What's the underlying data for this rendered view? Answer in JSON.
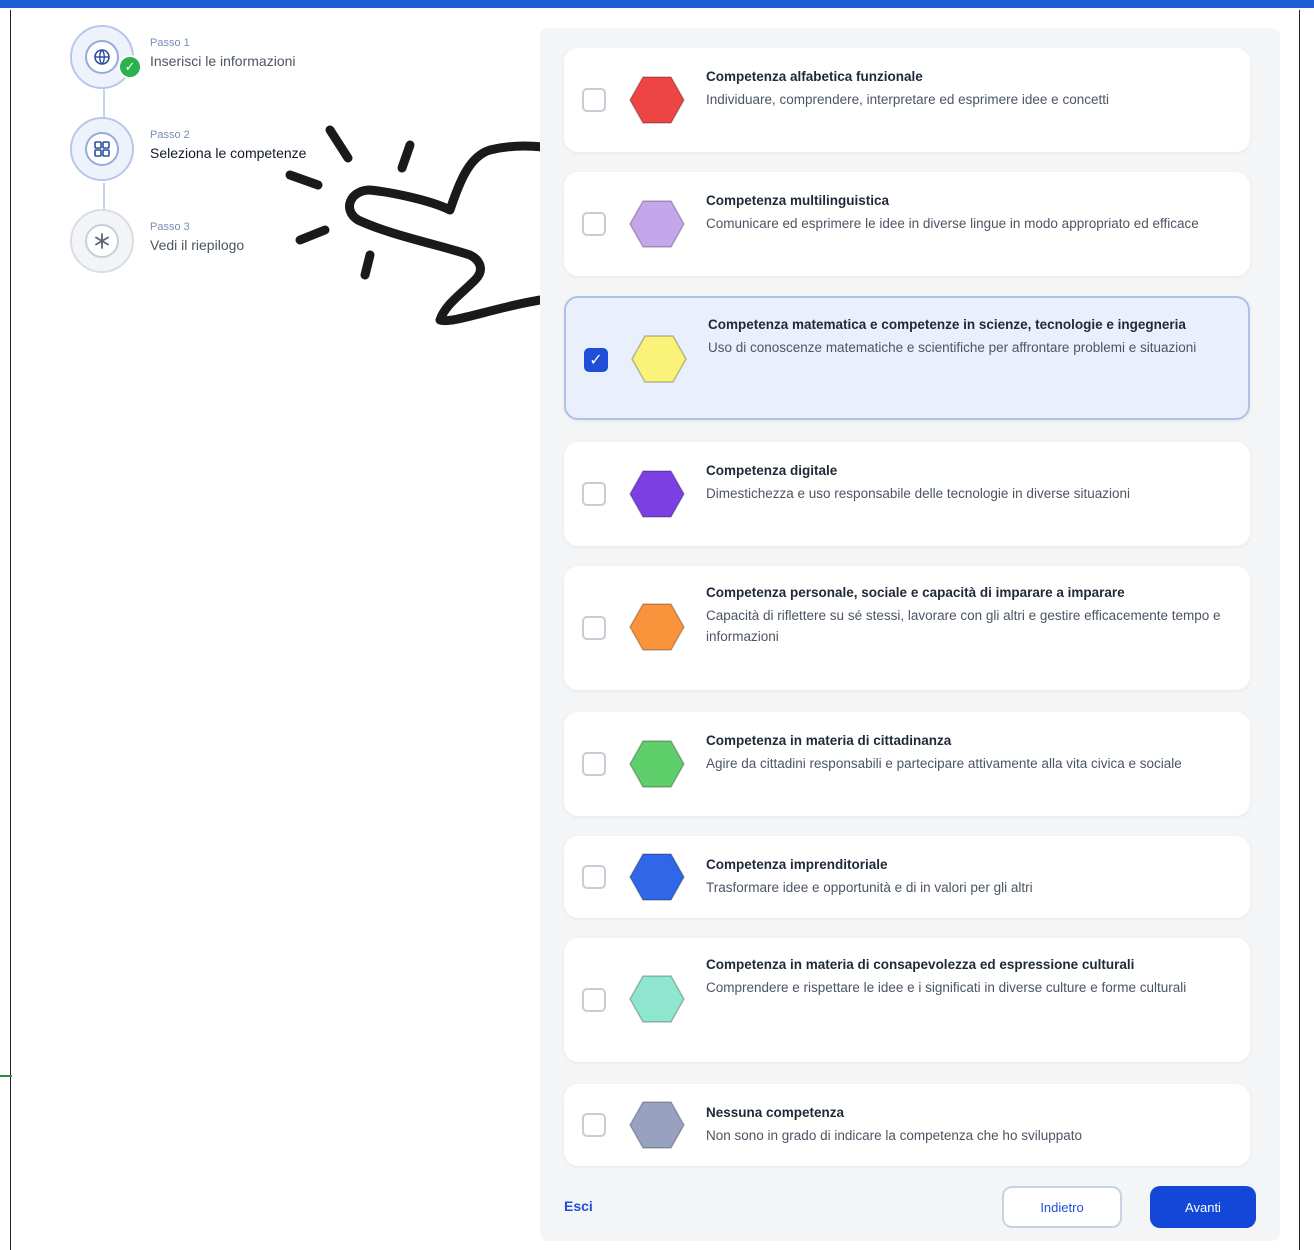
{
  "stepper": {
    "steps": [
      {
        "sub": "Passo 1",
        "title": "Inserisci le informazioni",
        "icon": "globe-icon",
        "status": "completed"
      },
      {
        "sub": "Passo 2",
        "title": "Seleziona le competenze",
        "icon": "grid-icon",
        "status": "active"
      },
      {
        "sub": "Passo 3",
        "title": "Vedi il riepilogo",
        "icon": "asterisk-icon",
        "status": "upcoming"
      }
    ]
  },
  "competences": [
    {
      "title": "Competenza alfabetica funzionale",
      "desc": "Individuare, comprendere, interpretare ed esprimere idee e concetti",
      "color": "#ef4444",
      "checked": false
    },
    {
      "title": "Competenza multilinguistica",
      "desc": "Comunicare ed esprimere le idee in diverse lingue in modo appropriato ed efficace",
      "color": "#c4a6ec",
      "checked": false
    },
    {
      "title": "Competenza matematica e competenze in scienze, tecnologie e ingegneria",
      "desc": "Uso di conoscenze matematiche e scientifiche per affrontare problemi e situazioni",
      "color": "#fbf27a",
      "checked": true
    },
    {
      "title": "Competenza digitale",
      "desc": "Dimestichezza e uso responsabile delle tecnologie in diverse situazioni",
      "color": "#7b3fe4",
      "checked": false
    },
    {
      "title": "Competenza personale, sociale e capacità di imparare a imparare",
      "desc": "Capacità di riflettere su sé stessi, lavorare con gli altri e gestire efficacemente tempo e informazioni",
      "color": "#fb923c",
      "checked": false
    },
    {
      "title": "Competenza in materia di cittadinanza",
      "desc": "Agire da cittadini responsabili e partecipare attivamente alla vita civica e sociale",
      "color": "#5fcf6b",
      "checked": false
    },
    {
      "title": "Competenza imprenditoriale",
      "desc": "Trasformare idee e opportunità e di in valori per gli altri",
      "color": "#2f67e8",
      "checked": false
    },
    {
      "title": "Competenza in materia di consapevolezza ed espressione culturali",
      "desc": "Comprendere e rispettare le idee e i significati in diverse culture e forme culturali",
      "color": "#8ee6cf",
      "checked": false
    },
    {
      "title": "Nessuna competenza",
      "desc": "Non sono in grado di indicare la competenza che ho sviluppato",
      "color": "#98a2c0",
      "checked": false
    }
  ],
  "footer": {
    "exit_label": "Esci",
    "back_label": "Indietro",
    "next_label": "Avanti"
  },
  "colors": {
    "accent": "#1347d8",
    "top_bar": "#1c5fd4"
  }
}
